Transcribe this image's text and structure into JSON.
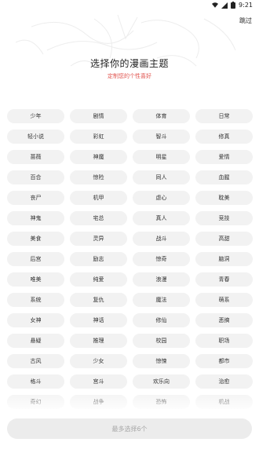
{
  "status_bar": {
    "time": "9:21",
    "icons": [
      "wifi-icon",
      "signal-icon",
      "battery-icon"
    ]
  },
  "header": {
    "skip_label": "跳过"
  },
  "intro": {
    "title": "选择你的漫画主题",
    "subtitle": "定制您的个性喜好"
  },
  "topics": [
    "少年",
    "剧情",
    "体育",
    "日常",
    "轻小说",
    "彩虹",
    "智斗",
    "修真",
    "蔷薇",
    "神魔",
    "明星",
    "爱情",
    "百合",
    "惊险",
    "同人",
    "血腥",
    "丧尸",
    "机甲",
    "虐心",
    "耽美",
    "神鬼",
    "宅总",
    "真人",
    "竞技",
    "美食",
    "灵异",
    "战斗",
    "高甜",
    "后宫",
    "励志",
    "惊奇",
    "脑洞",
    "唯美",
    "纯爱",
    "浪漫",
    "青春",
    "系统",
    "复仇",
    "魔法",
    "萌系",
    "女神",
    "神话",
    "修仙",
    "恶搞",
    "悬疑",
    "推理",
    "校园",
    "职场",
    "古风",
    "少女",
    "惊悚",
    "都市",
    "格斗",
    "宫斗",
    "欢乐向",
    "治愈",
    "奇幻",
    "战争",
    "恐怖",
    "机战"
  ],
  "footer": {
    "confirm_label": "最多选择6个"
  },
  "colors": {
    "accent": "#e0544f",
    "tag_bg": "#f2f2f2",
    "button_bg": "#ececec",
    "button_text": "#a7a7a7"
  }
}
